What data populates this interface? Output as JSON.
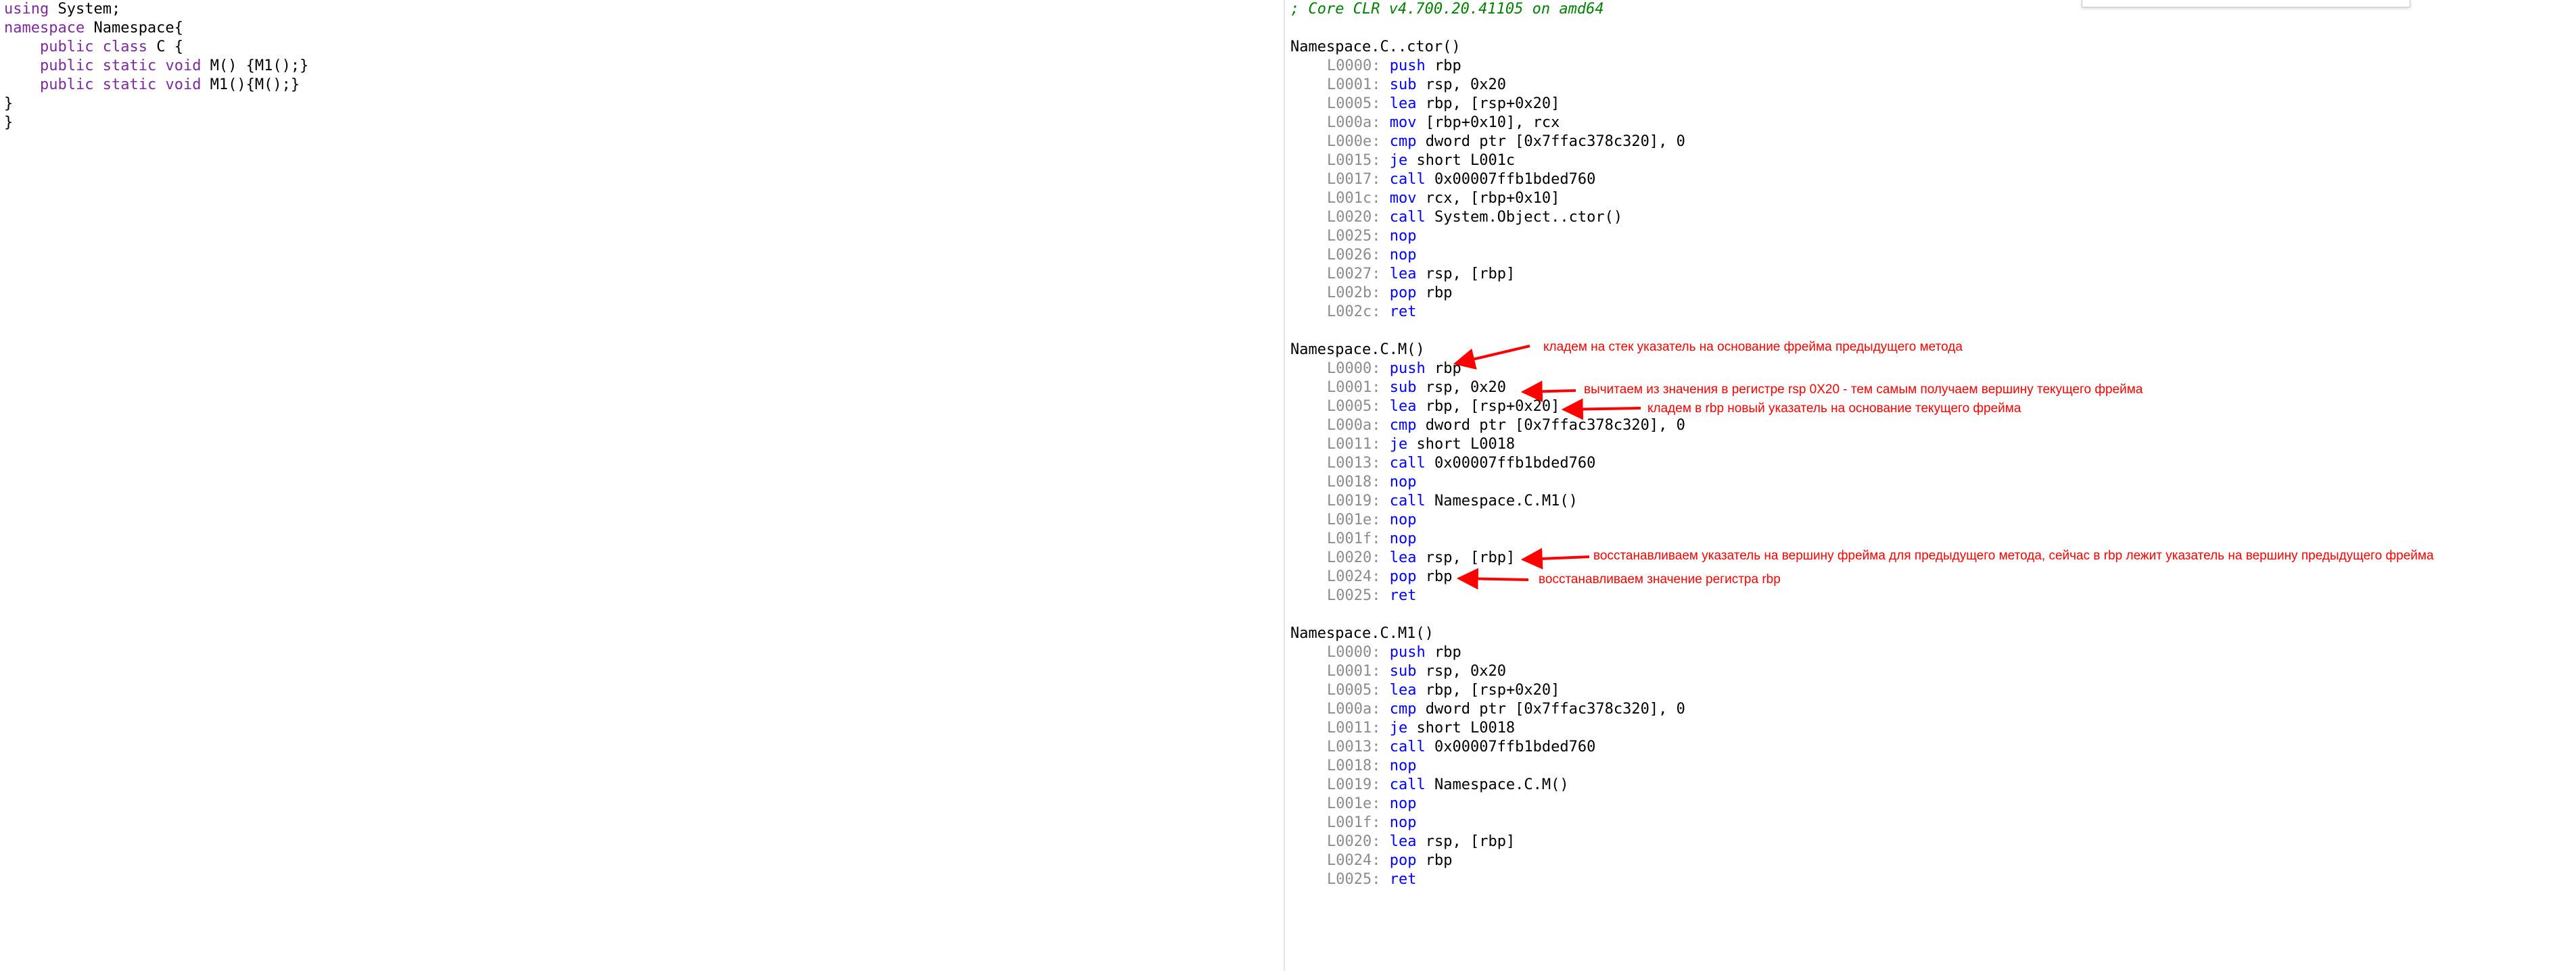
{
  "source": {
    "lines": [
      [
        {
          "t": "using",
          "c": "kw"
        },
        {
          "t": " System;"
        }
      ],
      [
        {
          "t": "namespace",
          "c": "kw"
        },
        {
          "t": " Namespace{"
        }
      ],
      [
        {
          "t": "    "
        },
        {
          "t": "public",
          "c": "kw"
        },
        {
          "t": " "
        },
        {
          "t": "class",
          "c": "kw"
        },
        {
          "t": " C {"
        }
      ],
      [
        {
          "t": "    "
        },
        {
          "t": "public",
          "c": "kw"
        },
        {
          "t": " "
        },
        {
          "t": "static",
          "c": "kw"
        },
        {
          "t": " "
        },
        {
          "t": "void",
          "c": "kw"
        },
        {
          "t": " M() {M1();}"
        }
      ],
      [
        {
          "t": "    "
        },
        {
          "t": "public",
          "c": "kw"
        },
        {
          "t": " "
        },
        {
          "t": "static",
          "c": "kw"
        },
        {
          "t": " "
        },
        {
          "t": "void",
          "c": "kw"
        },
        {
          "t": " M1(){M();}"
        }
      ],
      [
        {
          "t": "}"
        }
      ],
      [
        {
          "t": "}"
        }
      ]
    ]
  },
  "asm": {
    "header": "; Core CLR v4.700.20.41105 on amd64",
    "methods": [
      {
        "name": "Namespace.C..ctor()",
        "instructions": [
          {
            "label": "L0000:",
            "op": "push",
            "args": "rbp"
          },
          {
            "label": "L0001:",
            "op": "sub",
            "args": "rsp, 0x20"
          },
          {
            "label": "L0005:",
            "op": "lea",
            "args": "rbp, [rsp+0x20]"
          },
          {
            "label": "L000a:",
            "op": "mov",
            "args": "[rbp+0x10], rcx"
          },
          {
            "label": "L000e:",
            "op": "cmp",
            "args": "dword ptr [0x7ffac378c320], 0"
          },
          {
            "label": "L0015:",
            "op": "je",
            "args": "short L001c"
          },
          {
            "label": "L0017:",
            "op": "call",
            "args": "0x00007ffb1bded760"
          },
          {
            "label": "L001c:",
            "op": "mov",
            "args": "rcx, [rbp+0x10]"
          },
          {
            "label": "L0020:",
            "op": "call",
            "args": "System.Object..ctor()"
          },
          {
            "label": "L0025:",
            "op": "nop",
            "args": ""
          },
          {
            "label": "L0026:",
            "op": "nop",
            "args": ""
          },
          {
            "label": "L0027:",
            "op": "lea",
            "args": "rsp, [rbp]"
          },
          {
            "label": "L002b:",
            "op": "pop",
            "args": "rbp"
          },
          {
            "label": "L002c:",
            "op": "ret",
            "args": ""
          }
        ]
      },
      {
        "name": "Namespace.C.M()",
        "instructions": [
          {
            "label": "L0000:",
            "op": "push",
            "args": "rbp"
          },
          {
            "label": "L0001:",
            "op": "sub",
            "args": "rsp, 0x20"
          },
          {
            "label": "L0005:",
            "op": "lea",
            "args": "rbp, [rsp+0x20]"
          },
          {
            "label": "L000a:",
            "op": "cmp",
            "args": "dword ptr [0x7ffac378c320], 0"
          },
          {
            "label": "L0011:",
            "op": "je",
            "args": "short L0018"
          },
          {
            "label": "L0013:",
            "op": "call",
            "args": "0x00007ffb1bded760"
          },
          {
            "label": "L0018:",
            "op": "nop",
            "args": ""
          },
          {
            "label": "L0019:",
            "op": "call",
            "args": "Namespace.C.M1()"
          },
          {
            "label": "L001e:",
            "op": "nop",
            "args": ""
          },
          {
            "label": "L001f:",
            "op": "nop",
            "args": ""
          },
          {
            "label": "L0020:",
            "op": "lea",
            "args": "rsp, [rbp]"
          },
          {
            "label": "L0024:",
            "op": "pop",
            "args": "rbp"
          },
          {
            "label": "L0025:",
            "op": "ret",
            "args": ""
          }
        ]
      },
      {
        "name": "Namespace.C.M1()",
        "instructions": [
          {
            "label": "L0000:",
            "op": "push",
            "args": "rbp"
          },
          {
            "label": "L0001:",
            "op": "sub",
            "args": "rsp, 0x20"
          },
          {
            "label": "L0005:",
            "op": "lea",
            "args": "rbp, [rsp+0x20]"
          },
          {
            "label": "L000a:",
            "op": "cmp",
            "args": "dword ptr [0x7ffac378c320], 0"
          },
          {
            "label": "L0011:",
            "op": "je",
            "args": "short L0018"
          },
          {
            "label": "L0013:",
            "op": "call",
            "args": "0x00007ffb1bded760"
          },
          {
            "label": "L0018:",
            "op": "nop",
            "args": ""
          },
          {
            "label": "L0019:",
            "op": "call",
            "args": "Namespace.C.M()"
          },
          {
            "label": "L001e:",
            "op": "nop",
            "args": ""
          },
          {
            "label": "L001f:",
            "op": "nop",
            "args": ""
          },
          {
            "label": "L0020:",
            "op": "lea",
            "args": "rsp, [rbp]"
          },
          {
            "label": "L0024:",
            "op": "pop",
            "args": "rbp"
          },
          {
            "label": "L0025:",
            "op": "ret",
            "args": ""
          }
        ]
      }
    ]
  },
  "annotations": [
    {
      "text": "кладем на стек указатель на основание фрейма предыдущего метода"
    },
    {
      "text": "вычитаем из значения в регистре rsp 0X20 - тем самым получаем вершину текущего фрейма"
    },
    {
      "text": "кладем в rbp  новый указатель на основание текущего фрейма"
    },
    {
      "text": "восстанавливаем указатель на вершину фрейма для предыдущего метода, сейчас в rbp лежит указатель на вершину предыдущего фрейма"
    },
    {
      "text": "восстанавливаем значение регистра rbp"
    }
  ],
  "colors": {
    "keyword": "#7c2a9e",
    "asm_keyword": "#0000ff",
    "line_label": "#8c8c8c",
    "comment": "#008000",
    "annotation": "#ff0000"
  }
}
